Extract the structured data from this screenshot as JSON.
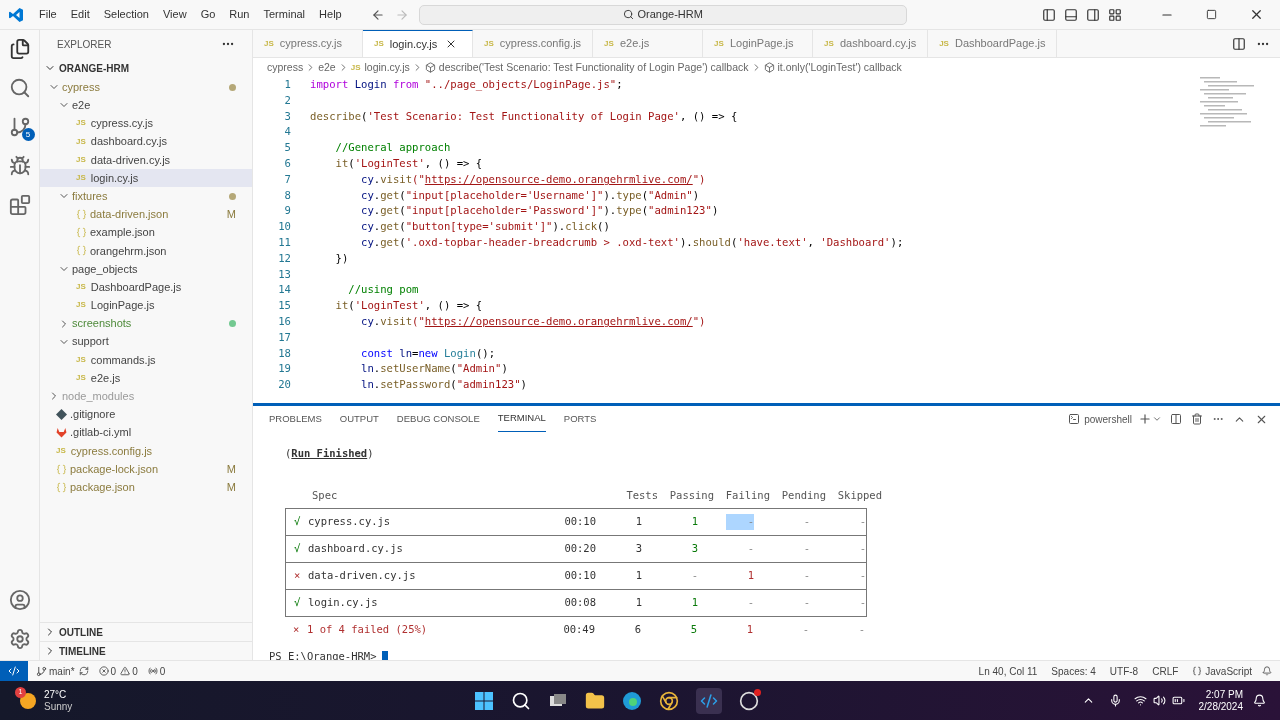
{
  "title_bar": {
    "menus": [
      "File",
      "Edit",
      "Selection",
      "View",
      "Go",
      "Run",
      "Terminal",
      "Help"
    ],
    "command_center": "Orange-HRM"
  },
  "activity_bar": {
    "source_control_badge": "5"
  },
  "explorer": {
    "title": "EXPLORER",
    "root": "ORANGE-HRM",
    "tree": [
      {
        "name": "cypress",
        "kind": "folder",
        "expanded": true,
        "selected": false,
        "modified": true,
        "untracked": false,
        "ignored": false,
        "color": "#b5a878",
        "children": [
          {
            "name": "e2e",
            "kind": "folder",
            "expanded": true,
            "selected": false,
            "modified": false,
            "untracked": false,
            "ignored": false,
            "children": [
              {
                "name": "cypress.cy.js",
                "kind": "js",
                "icon_label": "JS",
                "selected": false,
                "modified": false,
                "untracked": false,
                "ignored": false
              },
              {
                "name": "dashboard.cy.js",
                "kind": "js",
                "icon_label": "JS",
                "selected": false,
                "modified": false,
                "untracked": false,
                "ignored": false
              },
              {
                "name": "data-driven.cy.js",
                "kind": "js",
                "icon_label": "JS",
                "selected": false,
                "modified": false,
                "untracked": false,
                "ignored": false
              },
              {
                "name": "login.cy.js",
                "kind": "js",
                "icon_label": "JS",
                "selected": true,
                "modified": false,
                "untracked": false,
                "ignored": false
              }
            ]
          },
          {
            "name": "fixtures",
            "kind": "folder",
            "expanded": true,
            "selected": false,
            "modified": true,
            "untracked": false,
            "ignored": false,
            "color": "#b5a878",
            "children": [
              {
                "name": "data-driven.json",
                "kind": "json",
                "selected": false,
                "modified": true,
                "untracked": false,
                "ignored": false,
                "badge": "M"
              },
              {
                "name": "example.json",
                "kind": "json",
                "selected": false,
                "modified": false,
                "untracked": false,
                "ignored": false
              },
              {
                "name": "orangehrm.json",
                "kind": "json",
                "selected": false,
                "modified": false,
                "untracked": false,
                "ignored": false
              }
            ]
          },
          {
            "name": "page_objects",
            "kind": "folder",
            "expanded": true,
            "selected": false,
            "modified": false,
            "untracked": false,
            "ignored": false,
            "children": [
              {
                "name": "DashboardPage.js",
                "kind": "js",
                "icon_label": "JS",
                "selected": false,
                "modified": false,
                "untracked": false,
                "ignored": false
              },
              {
                "name": "LoginPage.js",
                "kind": "js",
                "icon_label": "JS",
                "selected": false,
                "modified": false,
                "untracked": false,
                "ignored": false
              }
            ]
          },
          {
            "name": "screenshots",
            "kind": "folder",
            "expanded": false,
            "selected": false,
            "modified": false,
            "untracked": true,
            "ignored": false,
            "color": "#73c991"
          },
          {
            "name": "support",
            "kind": "folder",
            "expanded": true,
            "selected": false,
            "modified": false,
            "untracked": false,
            "ignored": false,
            "children": [
              {
                "name": "commands.js",
                "kind": "js",
                "icon_label": "JS",
                "selected": false,
                "modified": false,
                "untracked": false,
                "ignored": false
              },
              {
                "name": "e2e.js",
                "kind": "js",
                "icon_label": "JS",
                "selected": false,
                "modified": false,
                "untracked": false,
                "ignored": false
              }
            ]
          }
        ]
      },
      {
        "name": "node_modules",
        "kind": "folder",
        "expanded": false,
        "selected": false,
        "modified": false,
        "untracked": false,
        "ignored": true
      },
      {
        "name": ".gitignore",
        "kind": "git",
        "selected": false,
        "modified": false,
        "untracked": false,
        "ignored": false
      },
      {
        "name": ".gitlab-ci.yml",
        "kind": "gitlab",
        "selected": false,
        "modified": false,
        "untracked": false,
        "ignored": false
      },
      {
        "name": "cypress.config.js",
        "kind": "js",
        "icon_label": "JS",
        "selected": false,
        "modified": true,
        "untracked": false,
        "ignored": false
      },
      {
        "name": "package-lock.json",
        "kind": "json",
        "selected": false,
        "modified": true,
        "untracked": false,
        "ignored": false,
        "badge": "M"
      },
      {
        "name": "package.json",
        "kind": "json",
        "selected": false,
        "modified": true,
        "untracked": false,
        "ignored": false,
        "badge": "M"
      }
    ],
    "sections": [
      "OUTLINE",
      "TIMELINE"
    ]
  },
  "tabs": [
    {
      "label": "cypress.cy.js",
      "icon_label": "JS",
      "selected": false
    },
    {
      "label": "login.cy.js",
      "icon_label": "JS",
      "selected": true
    },
    {
      "label": "cypress.config.js",
      "icon_label": "JS",
      "selected": false
    },
    {
      "label": "e2e.js",
      "icon_label": "JS",
      "selected": false
    },
    {
      "label": "LoginPage.js",
      "icon_label": "JS",
      "selected": false
    },
    {
      "label": "dashboard.cy.js",
      "icon_label": "JS",
      "selected": false
    },
    {
      "label": "DashboardPage.js",
      "icon_label": "JS",
      "selected": false
    }
  ],
  "breadcrumb": [
    {
      "label": "cypress",
      "kind": "folder"
    },
    {
      "label": "e2e",
      "kind": "folder"
    },
    {
      "label": "login.cy.js",
      "kind": "js",
      "icon_label": "JS"
    },
    {
      "label": "describe('Test Scenario: Test Functionality of Login Page') callback",
      "kind": "symbol"
    },
    {
      "label": "it.only('LoginTest') callback",
      "kind": "symbol"
    }
  ],
  "code": [
    {
      "num": "1",
      "tokens": [
        {
          "t": "import",
          "kind": "control"
        },
        {
          "t": " Login ",
          "kind": "variable"
        },
        {
          "t": "from",
          "kind": "control"
        },
        {
          "t": " \"../page_objects/LoginPage.js\"",
          "kind": "string"
        },
        {
          "t": ";",
          "kind": "plain"
        }
      ]
    },
    {
      "num": "2"
    },
    {
      "num": "3",
      "tokens": [
        {
          "t": "describe",
          "kind": "function"
        },
        {
          "t": "(",
          "kind": "plain"
        },
        {
          "t": "'Test Scenario: Test Functionality of Login Page'",
          "kind": "string"
        },
        {
          "t": ", () => {",
          "kind": "plain"
        }
      ]
    },
    {
      "num": "4"
    },
    {
      "num": "5",
      "tokens": [
        {
          "t": "    //General approach",
          "kind": "comment"
        }
      ]
    },
    {
      "num": "6",
      "tokens": [
        {
          "t": "    it",
          "kind": "function"
        },
        {
          "t": "(",
          "kind": "plain"
        },
        {
          "t": "'LoginTest'",
          "kind": "string"
        },
        {
          "t": ", () => {",
          "kind": "plain"
        }
      ]
    },
    {
      "num": "7",
      "tokens": [
        {
          "t": "        cy",
          "kind": "variable"
        },
        {
          "t": ".",
          "kind": "plain"
        },
        {
          "t": "visit",
          "kind": "function"
        },
        {
          "t": "(\"",
          "kind": "string"
        },
        {
          "t": "https://opensource-demo.orangehrmlive.com/",
          "kind": "link"
        },
        {
          "t": "\")",
          "kind": "string"
        }
      ]
    },
    {
      "num": "8",
      "tokens": [
        {
          "t": "        cy",
          "kind": "variable"
        },
        {
          "t": ".",
          "kind": "plain"
        },
        {
          "t": "get",
          "kind": "function"
        },
        {
          "t": "(",
          "kind": "plain"
        },
        {
          "t": "\"input[placeholder='Username']\"",
          "kind": "string"
        },
        {
          "t": ").",
          "kind": "plain"
        },
        {
          "t": "type",
          "kind": "function"
        },
        {
          "t": "(",
          "kind": "plain"
        },
        {
          "t": "\"Admin\"",
          "kind": "string"
        },
        {
          "t": ")",
          "kind": "plain"
        }
      ]
    },
    {
      "num": "9",
      "tokens": [
        {
          "t": "        cy",
          "kind": "variable"
        },
        {
          "t": ".",
          "kind": "plain"
        },
        {
          "t": "get",
          "kind": "function"
        },
        {
          "t": "(",
          "kind": "plain"
        },
        {
          "t": "\"input[placeholder='Password']\"",
          "kind": "string"
        },
        {
          "t": ").",
          "kind": "plain"
        },
        {
          "t": "type",
          "kind": "function"
        },
        {
          "t": "(",
          "kind": "plain"
        },
        {
          "t": "\"admin123\"",
          "kind": "string"
        },
        {
          "t": ")",
          "kind": "plain"
        }
      ]
    },
    {
      "num": "10",
      "tokens": [
        {
          "t": "        cy",
          "kind": "variable"
        },
        {
          "t": ".",
          "kind": "plain"
        },
        {
          "t": "get",
          "kind": "function"
        },
        {
          "t": "(",
          "kind": "plain"
        },
        {
          "t": "\"button[type='submit']\"",
          "kind": "string"
        },
        {
          "t": ").",
          "kind": "plain"
        },
        {
          "t": "click",
          "kind": "function"
        },
        {
          "t": "()",
          "kind": "plain"
        }
      ]
    },
    {
      "num": "11",
      "tokens": [
        {
          "t": "        cy",
          "kind": "variable"
        },
        {
          "t": ".",
          "kind": "plain"
        },
        {
          "t": "get",
          "kind": "function"
        },
        {
          "t": "(",
          "kind": "plain"
        },
        {
          "t": "'.oxd-topbar-header-breadcrumb > .oxd-text'",
          "kind": "string"
        },
        {
          "t": ").",
          "kind": "plain"
        },
        {
          "t": "should",
          "kind": "function"
        },
        {
          "t": "(",
          "kind": "plain"
        },
        {
          "t": "'have.text'",
          "kind": "string"
        },
        {
          "t": ", ",
          "kind": "plain"
        },
        {
          "t": "'Dashboard'",
          "kind": "string"
        },
        {
          "t": ");",
          "kind": "plain"
        }
      ]
    },
    {
      "num": "12",
      "tokens": [
        {
          "t": "    })",
          "kind": "plain"
        }
      ]
    },
    {
      "num": "13"
    },
    {
      "num": "14",
      "tokens": [
        {
          "t": "      //using pom",
          "kind": "comment"
        }
      ]
    },
    {
      "num": "15",
      "tokens": [
        {
          "t": "    it",
          "kind": "function"
        },
        {
          "t": "(",
          "kind": "plain"
        },
        {
          "t": "'LoginTest'",
          "kind": "string"
        },
        {
          "t": ", () => {",
          "kind": "plain"
        }
      ]
    },
    {
      "num": "16",
      "tokens": [
        {
          "t": "        cy",
          "kind": "variable"
        },
        {
          "t": ".",
          "kind": "plain"
        },
        {
          "t": "visit",
          "kind": "function"
        },
        {
          "t": "(\"",
          "kind": "string"
        },
        {
          "t": "https://opensource-demo.orangehrmlive.com/",
          "kind": "link"
        },
        {
          "t": "\")",
          "kind": "string"
        }
      ]
    },
    {
      "num": "17"
    },
    {
      "num": "18",
      "tokens": [
        {
          "t": "        const",
          "kind": "keyword"
        },
        {
          "t": " ln",
          "kind": "variable"
        },
        {
          "t": "=",
          "kind": "plain"
        },
        {
          "t": "new",
          "kind": "keyword"
        },
        {
          "t": " Login",
          "kind": "type"
        },
        {
          "t": "();",
          "kind": "plain"
        }
      ]
    },
    {
      "num": "19",
      "tokens": [
        {
          "t": "        ln",
          "kind": "variable"
        },
        {
          "t": ".",
          "kind": "plain"
        },
        {
          "t": "setUserName",
          "kind": "function"
        },
        {
          "t": "(",
          "kind": "plain"
        },
        {
          "t": "\"Admin\"",
          "kind": "string"
        },
        {
          "t": ")",
          "kind": "plain"
        }
      ]
    },
    {
      "num": "20",
      "tokens": [
        {
          "t": "        ln",
          "kind": "variable"
        },
        {
          "t": ".",
          "kind": "plain"
        },
        {
          "t": "setPassword",
          "kind": "function"
        },
        {
          "t": "(",
          "kind": "plain"
        },
        {
          "t": "\"admin123\"",
          "kind": "string"
        },
        {
          "t": ")",
          "kind": "plain"
        }
      ]
    }
  ],
  "panel": {
    "tabs": [
      {
        "label": "PROBLEMS",
        "selected": false
      },
      {
        "label": "OUTPUT",
        "selected": false
      },
      {
        "label": "DEBUG CONSOLE",
        "selected": false
      },
      {
        "label": "TERMINAL",
        "selected": true
      },
      {
        "label": "PORTS",
        "selected": false
      }
    ],
    "shell": "powershell",
    "run_finished": "(**Run Finished**)",
    "columns": [
      "Spec",
      "Tests",
      "Passing",
      "Failing",
      "Pending",
      "Skipped"
    ],
    "rows": [
      {
        "passed": true,
        "mark": "√",
        "spec": "cypress.cy.js",
        "time": "00:10",
        "tests": "1",
        "passing": "1",
        "failing": "-",
        "pending": "-",
        "skipped": "-",
        "failing_selected": true
      },
      {
        "passed": true,
        "mark": "√",
        "spec": "dashboard.cy.js",
        "time": "00:20",
        "tests": "3",
        "passing": "3",
        "failing": "-",
        "pending": "-",
        "skipped": "-",
        "failing_selected": false
      },
      {
        "passed": false,
        "mark": "×",
        "spec": "data-driven.cy.js",
        "time": "00:10",
        "tests": "1",
        "passing": "-",
        "failing": "1",
        "pending": "-",
        "skipped": "-",
        "failing_selected": false
      },
      {
        "passed": true,
        "mark": "√",
        "spec": "login.cy.js",
        "time": "00:08",
        "tests": "1",
        "passing": "1",
        "failing": "-",
        "pending": "-",
        "skipped": "-",
        "failing_selected": false
      }
    ],
    "summary": {
      "passed": false,
      "mark": "×",
      "spec": "1 of 4 failed (25%)",
      "time": "00:49",
      "tests": "6",
      "passing": "5",
      "failing": "1",
      "pending": "-",
      "skipped": "-"
    },
    "prompt": "PS E:\\Orange-HRM>"
  },
  "status_bar": {
    "branch": "main*",
    "errors": "0",
    "warnings": "0",
    "ports": "0",
    "right": [
      "Ln 40, Col 11",
      "Spaces: 4",
      "UTF-8",
      "CRLF"
    ],
    "language": "JavaScript"
  },
  "taskbar": {
    "weather_badge": "1",
    "temperature": "27°C",
    "condition": "Sunny",
    "time": "2:07 PM",
    "date": "2/28/2024"
  }
}
